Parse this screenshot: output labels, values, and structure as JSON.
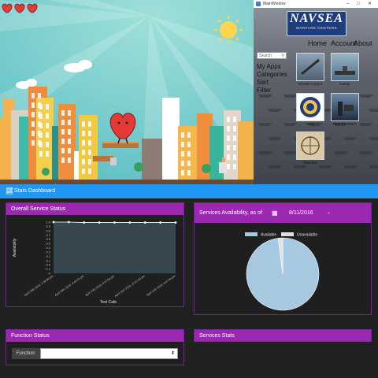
{
  "window": {
    "title": "MainWindow",
    "minimize": "–",
    "maximize": "□",
    "close": "✕"
  },
  "app": {
    "logo_text": "NAVSEA",
    "logo_sub": "WARFARE CENTERS",
    "nav": [
      "Home",
      "Account",
      "About"
    ],
    "search_placeholder": "Search",
    "sidebar": [
      "My Apps",
      "Categories",
      "Sort",
      "Filter"
    ],
    "tiles": [
      "Missile Control",
      "Carrier",
      "Navy",
      "Rear for Watch",
      "Reaches"
    ]
  },
  "dashboard": {
    "title": "Stats Dashboard",
    "accent": "#2196f3",
    "card_color": "#9c27b0",
    "overall": {
      "title": "Overall Service Status"
    },
    "availability": {
      "title": "Services Availability, as of",
      "date": "8/11/2016"
    },
    "function_status": {
      "title": "Function Status",
      "label": "Function:",
      "value": ""
    },
    "services_stats": {
      "title": "Services Stats"
    }
  },
  "chart_data": [
    {
      "type": "line",
      "ylabel": "Availability",
      "xlabel": "Test Cafe",
      "yticks": [
        "1.0",
        "0.9",
        "0.8",
        "0.7",
        "0.6",
        "0.5",
        "0.4",
        "0.3",
        "0.2",
        "0.1",
        "0.0",
        "-0.1",
        "-0"
      ],
      "ylim": [
        -0.2,
        1.0
      ],
      "categories": [
        "April 10th 2016, 2:38:08 pm",
        "April 10th 2016, 2:46:14 pm",
        "April 10th 2016, 6:47:09 pm",
        "April 11th 2016, 12:41:09 pm",
        "April 11th 2016, 6:47:09 pm"
      ],
      "series": [
        {
          "values": [
            1.0,
            1.0,
            0.99,
            0.99,
            0.99,
            0.99,
            0.99,
            0.99,
            0.99
          ]
        }
      ],
      "line_color": "#ffffff",
      "plot_bg": "#37474f"
    },
    {
      "type": "pie",
      "legend": [
        "Available",
        "Unavailable"
      ],
      "values": [
        98,
        2
      ],
      "colors": [
        "#a6c8e0",
        "#e0e0e0"
      ],
      "legend_position": "top"
    }
  ]
}
